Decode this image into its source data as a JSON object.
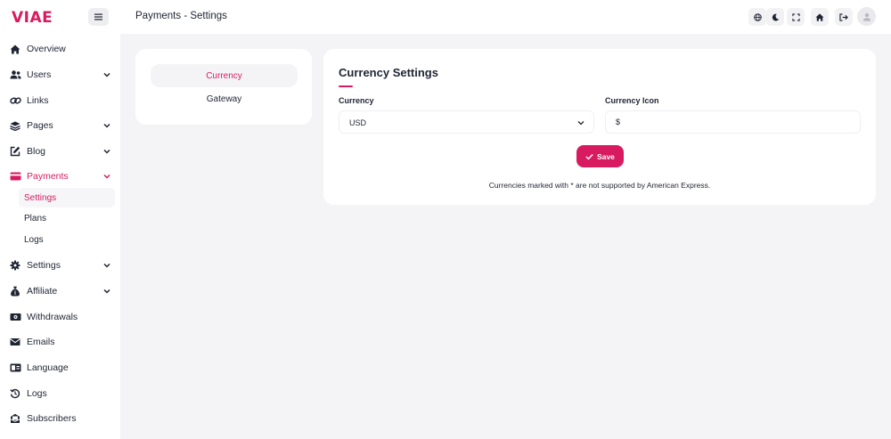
{
  "colors": {
    "accent": "#d81b60",
    "text": "#1f2433",
    "background": "#f4f4f6"
  },
  "brand": {
    "logo_text": "VIAE"
  },
  "header": {
    "title": "Payments - Settings"
  },
  "topbar_icons": [
    "globe-icon",
    "moon-icon",
    "fullscreen-icon",
    "home-icon",
    "logout-icon",
    "user-icon"
  ],
  "sidebar": {
    "items": [
      {
        "label": "Overview",
        "icon": "home-icon"
      },
      {
        "label": "Users",
        "icon": "users-icon"
      },
      {
        "label": "Links",
        "icon": "link-icon"
      },
      {
        "label": "Pages",
        "icon": "pages-icon"
      },
      {
        "label": "Blog",
        "icon": "edit-icon"
      },
      {
        "label": "Payments",
        "icon": "credit-card-icon"
      },
      {
        "label": "Settings",
        "icon": "gear-icon"
      },
      {
        "label": "Affiliate",
        "icon": "money-bag-icon"
      },
      {
        "label": "Withdrawals",
        "icon": "banknote-icon"
      },
      {
        "label": "Emails",
        "icon": "envelope-icon"
      },
      {
        "label": "Language",
        "icon": "language-icon"
      },
      {
        "label": "Logs",
        "icon": "history-icon"
      },
      {
        "label": "Subscribers",
        "icon": "inbox-icon"
      }
    ],
    "payments_sub": [
      {
        "label": "Settings"
      },
      {
        "label": "Plans"
      },
      {
        "label": "Logs"
      }
    ]
  },
  "settings_tabs": [
    {
      "label": "Currency"
    },
    {
      "label": "Gateway"
    }
  ],
  "currency_settings": {
    "title": "Currency Settings",
    "currency_label": "Currency",
    "currency_value": "USD",
    "icon_label": "Currency Icon",
    "icon_value": "$",
    "save_label": "Save",
    "note": "Currencies marked with * are not supported by American Express."
  }
}
